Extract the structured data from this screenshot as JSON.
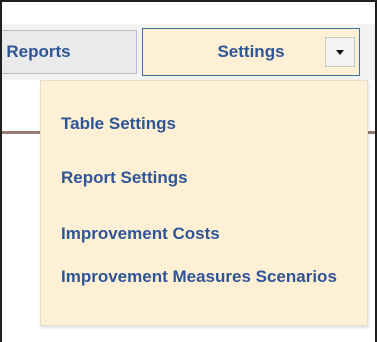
{
  "tabs": {
    "reports_label": "r Reports",
    "settings_label": "Settings"
  },
  "settings_menu": {
    "items": [
      {
        "label": "Table Settings"
      },
      {
        "label": "Report Settings"
      },
      {
        "label": "Improvement Costs"
      },
      {
        "label": "Improvement Measures Scenarios"
      }
    ]
  },
  "icons": {
    "dropdown_caret": "chevron-down-icon"
  },
  "colors": {
    "link_blue": "#2f5597",
    "menu_bg": "#fdf0d5",
    "active_border": "#3d6ea8",
    "divider": "#9a7a74"
  }
}
